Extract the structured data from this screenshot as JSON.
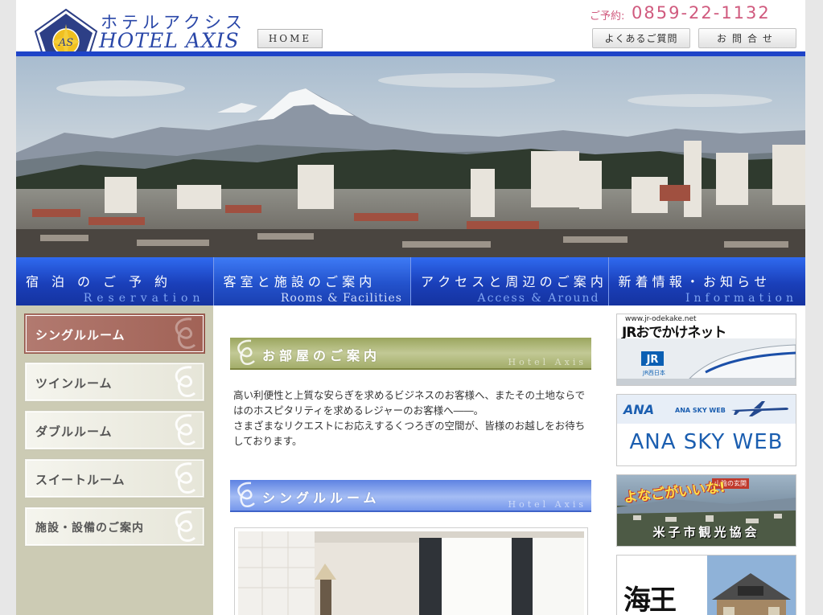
{
  "header": {
    "logo_kana": "ホテルアクシス",
    "logo_en": "HOTEL AXIS",
    "home_label": "HOME",
    "reservation_label": "ご予約:",
    "phone": "0859-22-1132",
    "faq_label": "よくあるご質問",
    "contact_label": "お問合せ"
  },
  "nav": {
    "items": [
      {
        "jp": "宿　泊　の　ご　予　約",
        "en": "Reservation"
      },
      {
        "jp": "客 室 と 施 設 の ご 案 内",
        "en": "Rooms & Facilities"
      },
      {
        "jp": "ア ク セ ス と 周 辺 の ご 案 内",
        "en": "Access & Around"
      },
      {
        "jp": "新 着 情 報 ・ お 知 ら せ",
        "en": "Information"
      }
    ]
  },
  "sidebar": {
    "items": [
      {
        "label": "シングルルーム"
      },
      {
        "label": "ツインルーム"
      },
      {
        "label": "ダブルルーム"
      },
      {
        "label": "スイートルーム"
      },
      {
        "label": "施設・設備のご案内"
      }
    ]
  },
  "main": {
    "section1_title": "お部屋のご案内",
    "section1_sub": "Hotel Axis",
    "intro": [
      "高い利便性と上質な安らぎを求めるビジネスのお客様へ、またその土地ならではのホスピタリティを求めるレジャーのお客様へ――。",
      "さまざまなリクエストにお応えするくつろぎの空間が、皆様のお越しをお待ちしております。"
    ],
    "section2_title": "シングルルーム",
    "section2_sub": "Hotel Axis"
  },
  "banners": {
    "jr_url": "www.jr-odekake.net",
    "jr_name": "JRおでかけネット",
    "jr_badge": "JR西日本",
    "ana_logo": "ANA",
    "ana_small": "ANA SKY WEB",
    "ana_big": "ANA SKY WEB",
    "kk_slogan": "よなごがいいな!",
    "kk_tag": "山陰の玄関",
    "kk_name": "米子市観光協会",
    "kaio_name": "海王"
  },
  "colors": {
    "brand_blue": "#1e44c8",
    "phone_pink": "#d05a7e",
    "sidebar_active": "#a16256",
    "sidebar_bg": "#cccbb4"
  }
}
